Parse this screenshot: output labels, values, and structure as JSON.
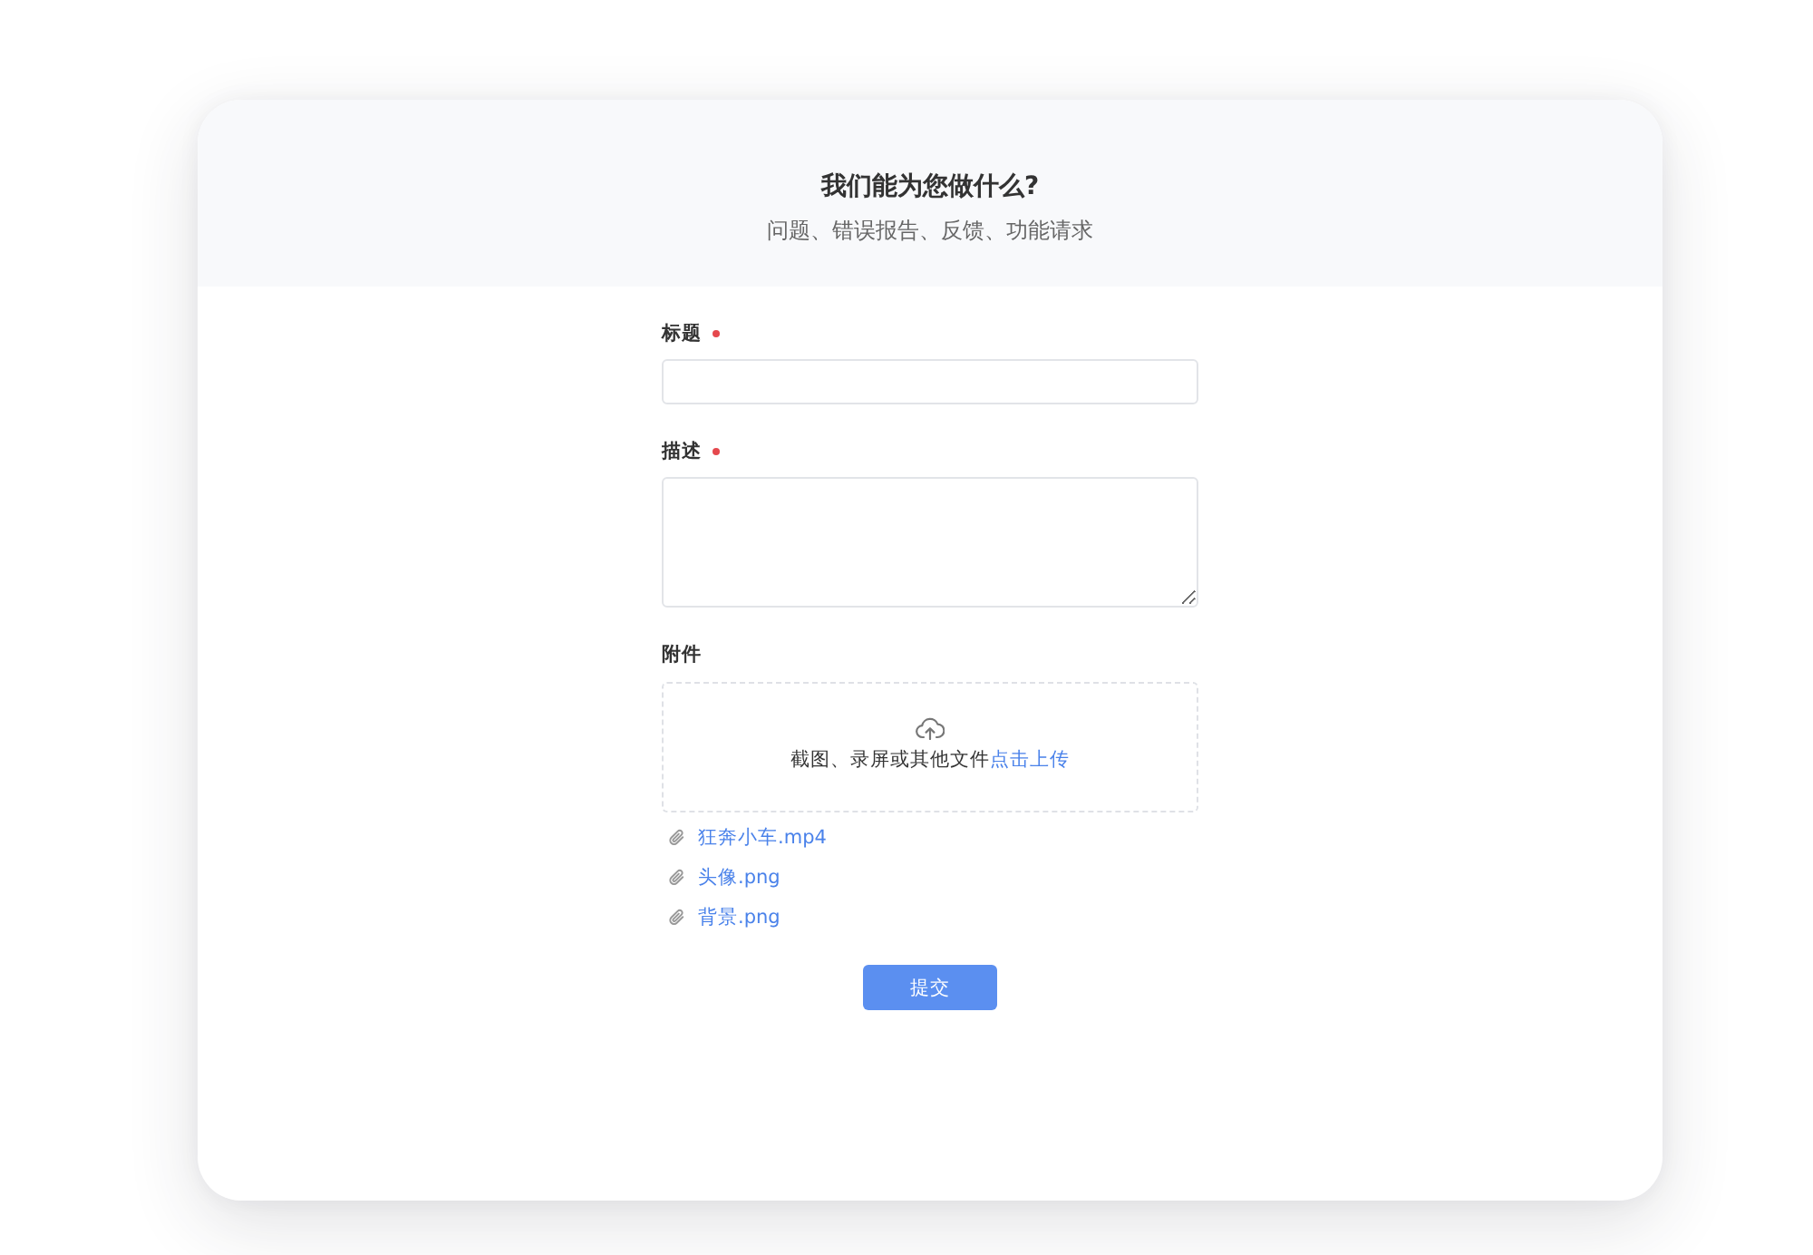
{
  "header": {
    "title": "我们能为您做什么?",
    "subtitle": "问题、错误报告、反馈、功能请求"
  },
  "fields": [
    {
      "kind": "input",
      "label": "标题",
      "required": true
    },
    {
      "kind": "textarea",
      "label": "描述",
      "required": true
    },
    {
      "kind": "upload",
      "label": "附件",
      "required": false,
      "hint": "截图、录屏或其他文件",
      "link": "点击上传"
    }
  ],
  "attachments": [
    "狂奔小车.mp4",
    "头像.png",
    "背景.png"
  ],
  "submit_button": "提交"
}
